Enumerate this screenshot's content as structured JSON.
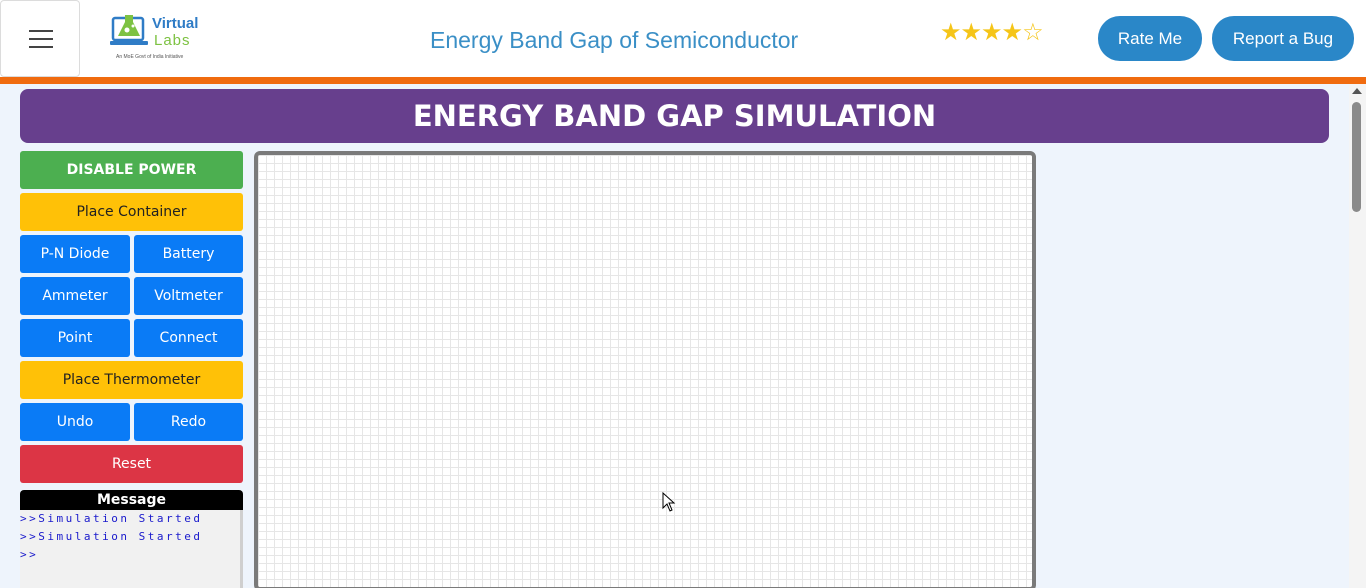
{
  "header": {
    "logo": {
      "line1": "Virtual",
      "line2": "Labs",
      "tagline": "An MoE Govt of India Initiative"
    },
    "title": "Energy Band Gap of Semiconductor",
    "rating": {
      "filled": 4,
      "total": 5
    },
    "rate_label": "Rate Me",
    "bug_label": "Report a Bug"
  },
  "banner": {
    "title": "ENERGY BAND GAP SIMULATION"
  },
  "controls": {
    "disable_power": "DISABLE POWER",
    "place_container": "Place Container",
    "pn_diode": "P-N Diode",
    "battery": "Battery",
    "ammeter": "Ammeter",
    "voltmeter": "Voltmeter",
    "point": "Point",
    "connect": "Connect",
    "place_thermometer": "Place Thermometer",
    "undo": "Undo",
    "redo": "Redo",
    "reset": "Reset"
  },
  "message": {
    "title": "Message",
    "lines": [
      ">>Simulation Started",
      ">>Simulation Started",
      ">>"
    ]
  },
  "colors": {
    "accent_blue": "#2a87c8",
    "banner_purple": "#673f8d",
    "orange_line": "#f06b0f",
    "button_green": "#4caf50",
    "button_yellow": "#ffc107",
    "button_blue": "#0a7bf6",
    "button_red": "#dc3545",
    "star_gold": "#f5c518"
  }
}
